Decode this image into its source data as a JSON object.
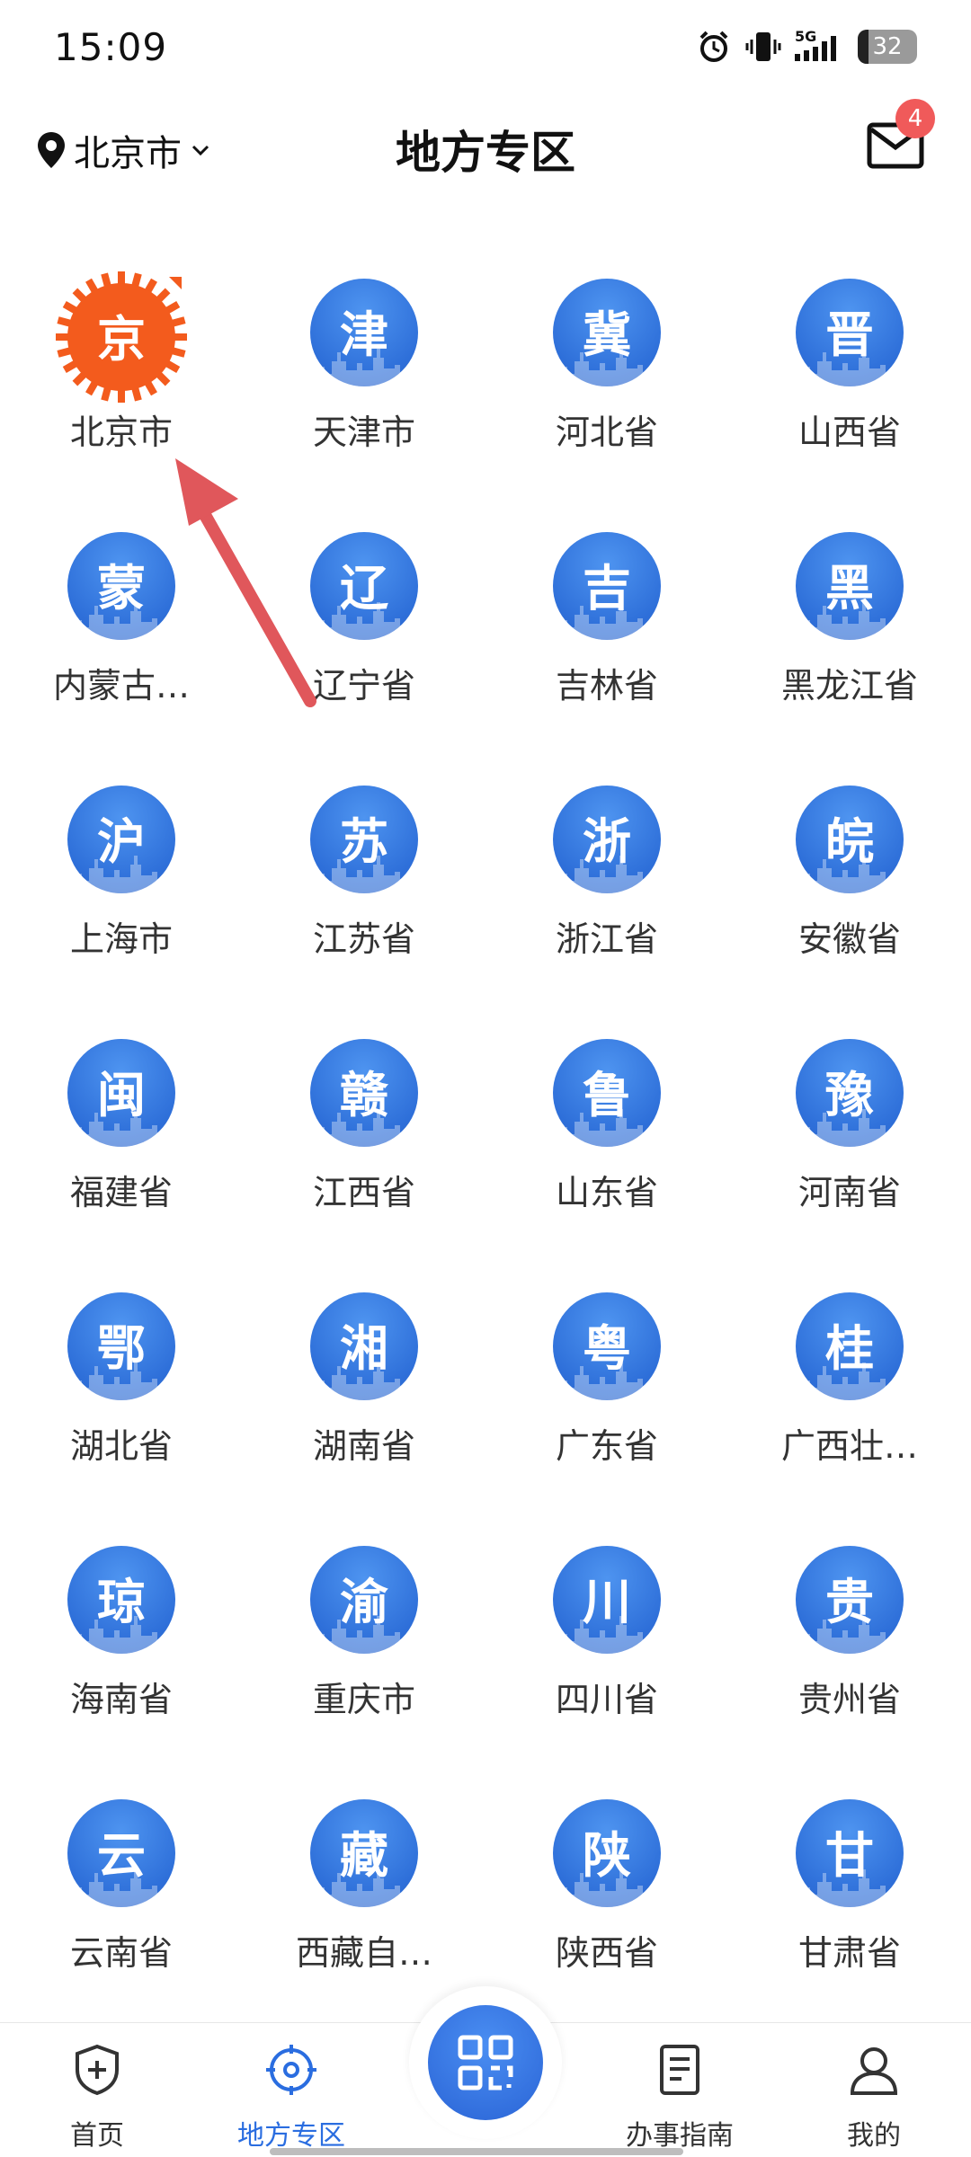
{
  "status_bar": {
    "time": "15:09",
    "network": "5G",
    "battery": "32"
  },
  "header": {
    "location": "北京市",
    "title": "地方专区",
    "mail_badge": "4"
  },
  "regions": [
    {
      "char": "京",
      "name": "北京市",
      "selected": true
    },
    {
      "char": "津",
      "name": "天津市"
    },
    {
      "char": "冀",
      "name": "河北省"
    },
    {
      "char": "晋",
      "name": "山西省"
    },
    {
      "char": "蒙",
      "name": "内蒙古…"
    },
    {
      "char": "辽",
      "name": "辽宁省"
    },
    {
      "char": "吉",
      "name": "吉林省"
    },
    {
      "char": "黑",
      "name": "黑龙江省"
    },
    {
      "char": "沪",
      "name": "上海市"
    },
    {
      "char": "苏",
      "name": "江苏省"
    },
    {
      "char": "浙",
      "name": "浙江省"
    },
    {
      "char": "皖",
      "name": "安徽省"
    },
    {
      "char": "闽",
      "name": "福建省"
    },
    {
      "char": "赣",
      "name": "江西省"
    },
    {
      "char": "鲁",
      "name": "山东省"
    },
    {
      "char": "豫",
      "name": "河南省"
    },
    {
      "char": "鄂",
      "name": "湖北省"
    },
    {
      "char": "湘",
      "name": "湖南省"
    },
    {
      "char": "粤",
      "name": "广东省"
    },
    {
      "char": "桂",
      "name": "广西壮…"
    },
    {
      "char": "琼",
      "name": "海南省"
    },
    {
      "char": "渝",
      "name": "重庆市"
    },
    {
      "char": "川",
      "name": "四川省"
    },
    {
      "char": "贵",
      "name": "贵州省"
    },
    {
      "char": "云",
      "name": "云南省"
    },
    {
      "char": "藏",
      "name": "西藏自…"
    },
    {
      "char": "陕",
      "name": "陕西省"
    },
    {
      "char": "甘",
      "name": "甘肃省"
    }
  ],
  "bottom_nav": [
    {
      "label": "首页",
      "icon": "shield-plus-icon"
    },
    {
      "label": "地方专区",
      "icon": "target-icon",
      "active": true
    },
    {
      "label": "",
      "icon": "qr-scan-icon"
    },
    {
      "label": "办事指南",
      "icon": "document-icon"
    },
    {
      "label": "我的",
      "icon": "user-icon"
    }
  ],
  "colors": {
    "accent": "#2a6de0",
    "icon_blue": "#2e6fd9",
    "beijing_orange": "#f35b1d",
    "badge_red": "#f05a5a",
    "arrow_red": "#e0575b"
  }
}
